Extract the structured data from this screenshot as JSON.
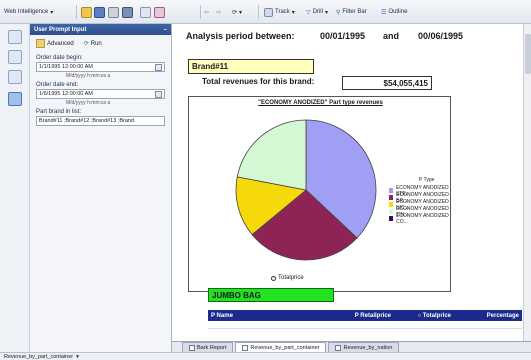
{
  "toolbar": {
    "app_menu": "Web Intelligence",
    "track": "Track",
    "drill": "Drill",
    "filter_bar": "Filter Bar",
    "outline": "Outline"
  },
  "panel": {
    "title": "User Prompt Input",
    "advanced": "Advanced",
    "run": "Run",
    "start_label": "Order date begin:",
    "start_value": "1/1/1995 12:00:00 AM",
    "start_hint": "M/d/yyyy h:mm:ss a",
    "end_label": "Order date end:",
    "end_value": "1/6/1995 12:00:00 AM",
    "end_hint": "M/d/yyyy h:mm:ss a",
    "brand_label": "Part brand in list:",
    "brand_value": "Brand#11 ;Brand#12 ;Brand#13 ;Brand"
  },
  "report": {
    "period_label": "Analysis period between:",
    "period_start": "00/01/1995",
    "period_and": "and",
    "period_end": "00/06/1995",
    "brand": "Brand#11",
    "total_label": "Total revenues for this brand:",
    "total_value": "$54,055,415",
    "green_label": "JUMBO BAG"
  },
  "chart_data": {
    "type": "pie",
    "title": "\"ECONOMY ANODIZED\" Part type revenues",
    "measure_label": "Totalprice",
    "legend_title": "P Type",
    "legend_position": "right",
    "slices": [
      {
        "name": "ECONOMY ANODIZED STE...",
        "value": 37,
        "color": "#9f9ff4"
      },
      {
        "name": "ECONOMY ANODIZED BR...",
        "value": 27,
        "color": "#8e2355"
      },
      {
        "name": "ECONOMY ANODIZED NIC...",
        "value": 14,
        "color": "#f5d90b"
      },
      {
        "name": "ECONOMY ANODIZED TIN...",
        "value": 22,
        "color": "#d3f8d3"
      },
      {
        "name": "ECONOMY ANODIZED CO...",
        "value": 0,
        "color": "#3a0a6b"
      }
    ]
  },
  "table": {
    "headers": [
      "P Name",
      "P Retailprice",
      "Totalprice",
      "Percentage"
    ],
    "rows": [
      [
        "",
        "",
        "",
        ""
      ]
    ]
  },
  "tabs": [
    "Bark Report",
    "Revenue_by_part_container",
    "Revenue_by_nation"
  ],
  "status": "Revenue_by_part_container"
}
